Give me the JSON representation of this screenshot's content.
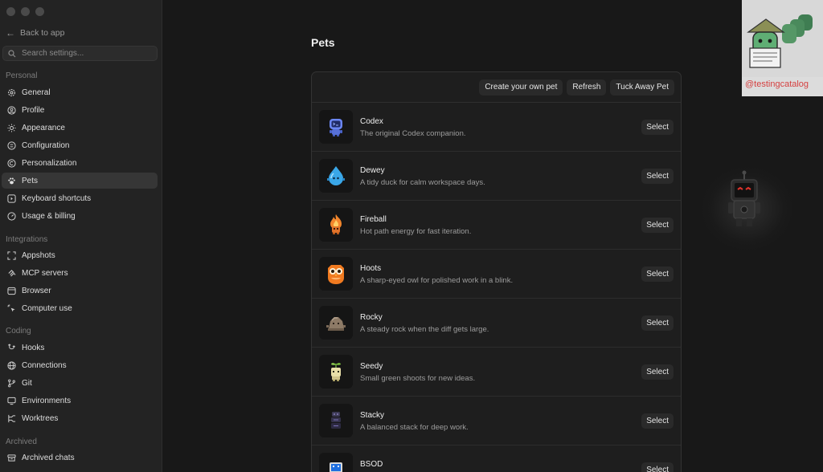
{
  "sidebar": {
    "back_label": "Back to app",
    "search_placeholder": "Search settings...",
    "sections": {
      "personal": "Personal",
      "integrations": "Integrations",
      "coding": "Coding",
      "archived": "Archived"
    },
    "items": {
      "general": "General",
      "profile": "Profile",
      "appearance": "Appearance",
      "configuration": "Configuration",
      "personalization": "Personalization",
      "pets": "Pets",
      "keyboard_shortcuts": "Keyboard shortcuts",
      "usage_billing": "Usage & billing",
      "appshots": "Appshots",
      "mcp_servers": "MCP servers",
      "browser": "Browser",
      "computer_use": "Computer use",
      "hooks": "Hooks",
      "connections": "Connections",
      "git": "Git",
      "environments": "Environments",
      "worktrees": "Worktrees",
      "archived_chats": "Archived chats"
    },
    "active_item": "pets"
  },
  "main": {
    "title": "Pets",
    "toolbar": {
      "create": "Create your own pet",
      "refresh": "Refresh",
      "tuck_away": "Tuck Away Pet"
    },
    "pets": [
      {
        "name": "Codex",
        "desc": "The original Codex companion.",
        "action": "Select",
        "icon": "codex-robot-icon"
      },
      {
        "name": "Dewey",
        "desc": "A tidy duck for calm workspace days.",
        "action": "Select",
        "icon": "water-drop-icon"
      },
      {
        "name": "Fireball",
        "desc": "Hot path energy for fast iteration.",
        "action": "Select",
        "icon": "fireball-icon"
      },
      {
        "name": "Hoots",
        "desc": "A sharp-eyed owl for polished work in a blink.",
        "action": "Select",
        "icon": "owl-icon"
      },
      {
        "name": "Rocky",
        "desc": "A steady rock when the diff gets large.",
        "action": "Select",
        "icon": "rock-icon"
      },
      {
        "name": "Seedy",
        "desc": "Small green shoots for new ideas.",
        "action": "Select",
        "icon": "sprout-icon"
      },
      {
        "name": "Stacky",
        "desc": "A balanced stack for deep work.",
        "action": "Select",
        "icon": "stack-icon"
      },
      {
        "name": "BSOD",
        "desc": "",
        "action": "Select",
        "icon": "bsod-monitor-icon"
      }
    ]
  },
  "watermark": {
    "handle": "@testingcatalog"
  },
  "colors": {
    "sidebar_bg": "#232323",
    "main_bg": "#181818",
    "panel_bg": "#1e1e1e",
    "button_bg": "#2a2a2a",
    "active_item_bg": "#363636",
    "watermark_text": "#d54040"
  }
}
